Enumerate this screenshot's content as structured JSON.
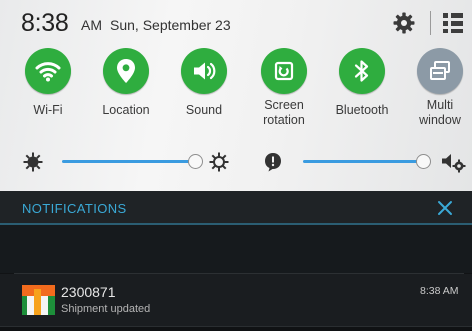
{
  "status_bar": {
    "time": "8:38",
    "ampm": "AM",
    "date": "Sun, September 23",
    "icons": [
      "settings-gear-icon",
      "grid-icon"
    ]
  },
  "quick_toggles": [
    {
      "label": "Wi-Fi",
      "icon": "wifi-icon",
      "state": "on"
    },
    {
      "label": "Location",
      "icon": "location-pin-icon",
      "state": "on"
    },
    {
      "label": "Sound",
      "icon": "speaker-icon",
      "state": "on"
    },
    {
      "label": "Screen\nrotation",
      "icon": "screen-rotation-icon",
      "state": "on"
    },
    {
      "label": "Bluetooth",
      "icon": "bluetooth-icon",
      "state": "on"
    },
    {
      "label": "Multi\nwindow",
      "icon": "multi-window-icon",
      "state": "off"
    }
  ],
  "sliders": {
    "brightness": {
      "level": 0.99,
      "left_icon": "brightness-low-icon",
      "right_icon": "brightness-auto-icon"
    },
    "notification_volume": {
      "level": 0.98,
      "left_icon": "alert-icon",
      "right_icon": "volume-settings-icon"
    }
  },
  "notifications": {
    "header": "NOTIFICATIONS",
    "clear_icon": "close-icon",
    "items": [
      {
        "title": "2300871",
        "text": "Shipment updated",
        "time": "8:38 AM",
        "icon": "app-icon"
      }
    ]
  },
  "colors": {
    "toggle_on": "#2fad3f",
    "toggle_off": "#8c9aa6",
    "slider_accent": "#3a9be0",
    "notif_header_text": "#3aa9d6",
    "dark_bg": "#161a1d"
  }
}
